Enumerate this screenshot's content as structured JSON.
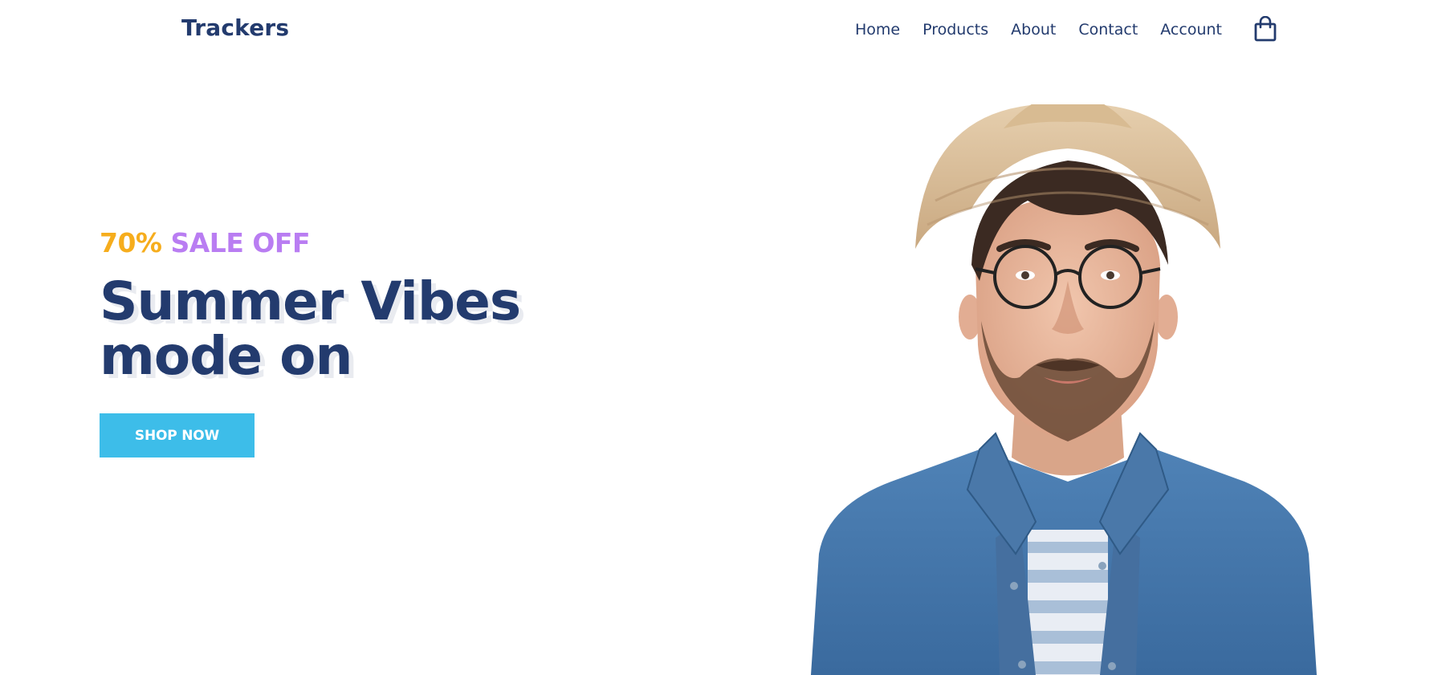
{
  "brand": {
    "logo_text": "Trackers",
    "primary_color": "#233b6e"
  },
  "nav": {
    "links": [
      "Home",
      "Products",
      "About",
      "Contact",
      "Account"
    ],
    "cart_icon": "shopping-bag-icon"
  },
  "hero": {
    "promo_percent": "70%",
    "promo_text": "SALE OFF",
    "headline_line1": "Summer Vibes",
    "headline_line2": "mode on",
    "cta_label": "SHOP NOW",
    "colors": {
      "percent": "#f6ad1d",
      "sale": "#b97df2",
      "cta": "#3dbde9"
    },
    "image": "man-in-straw-hat-glasses-denim-shirt"
  }
}
